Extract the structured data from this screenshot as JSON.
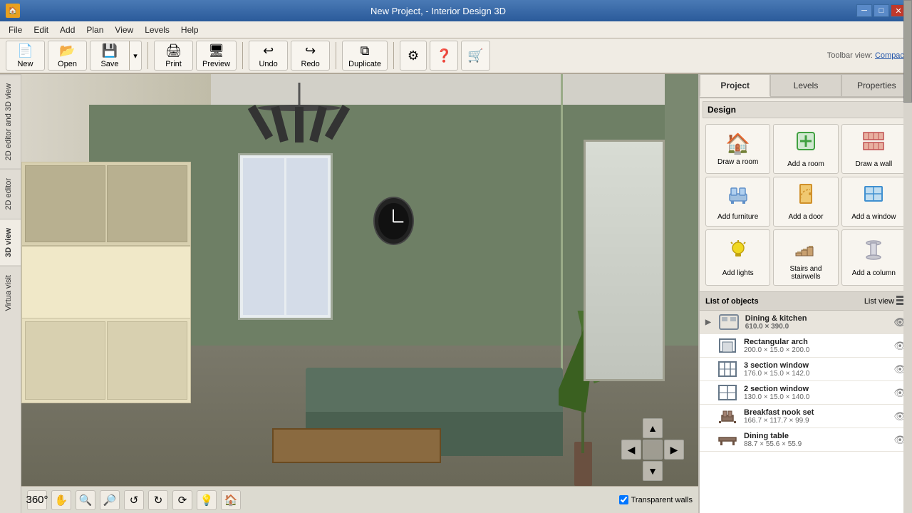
{
  "titlebar": {
    "title": "New Project, - Interior Design 3D",
    "app_icon": "🏠",
    "min_btn": "─",
    "max_btn": "□",
    "close_btn": "✕"
  },
  "menubar": {
    "items": [
      "File",
      "Edit",
      "Add",
      "Plan",
      "View",
      "Levels",
      "Help"
    ]
  },
  "toolbar": {
    "new_label": "New",
    "open_label": "Open",
    "save_label": "Save",
    "print_label": "Print",
    "preview_label": "Preview",
    "undo_label": "Undo",
    "redo_label": "Redo",
    "duplicate_label": "Duplicate",
    "settings_label": "⚙",
    "help_label": "?",
    "shop_label": "🛒",
    "toolbar_view_label": "Toolbar view:",
    "compact_label": "Compact"
  },
  "side_tabs": [
    {
      "id": "2d-3d",
      "label": "2D editor and 3D view"
    },
    {
      "id": "2d",
      "label": "2D editor"
    },
    {
      "id": "3d",
      "label": "3D view"
    },
    {
      "id": "virtual",
      "label": "Virtua visit"
    }
  ],
  "bottom_toolbar": {
    "buttons": [
      "360°",
      "✋",
      "🔍-",
      "🔍+",
      "↺",
      "↻",
      "⟳",
      "💡",
      "🏠"
    ],
    "transparent_walls_label": "Transparent walls"
  },
  "right_panel": {
    "tabs": [
      "Project",
      "Levels",
      "Properties"
    ],
    "active_tab": "Project",
    "design_section_title": "Design",
    "design_items": [
      {
        "id": "draw-room",
        "icon": "🏠",
        "label": "Draw a room"
      },
      {
        "id": "add-room",
        "icon": "➕",
        "label": "Add a room",
        "color": "green"
      },
      {
        "id": "draw-wall",
        "icon": "🧱",
        "label": "Draw a wall"
      },
      {
        "id": "add-furniture",
        "icon": "🪑",
        "label": "Add furniture"
      },
      {
        "id": "add-door",
        "icon": "🚪",
        "label": "Add a door"
      },
      {
        "id": "add-window",
        "icon": "🪟",
        "label": "Add a window"
      },
      {
        "id": "add-lights",
        "icon": "💡",
        "label": "Add lights"
      },
      {
        "id": "stairs",
        "icon": "🪜",
        "label": "Stairs and stairwells"
      },
      {
        "id": "add-column",
        "icon": "🏛",
        "label": "Add a column"
      }
    ],
    "objects_list_title": "List of objects",
    "list_view_label": "List view",
    "objects": [
      {
        "id": "dining-kitchen",
        "type": "group",
        "name": "Dining & kitchen",
        "size": "610.0 × 390.0"
      },
      {
        "id": "rect-arch",
        "type": "arch",
        "name": "Rectangular arch",
        "size": "200.0 × 15.0 × 200.0"
      },
      {
        "id": "3sec-window",
        "type": "window",
        "name": "3 section window",
        "size": "176.0 × 15.0 × 142.0"
      },
      {
        "id": "2sec-window",
        "type": "window",
        "name": "2 section window",
        "size": "130.0 × 15.0 × 140.0"
      },
      {
        "id": "breakfast-nook",
        "type": "furniture",
        "name": "Breakfast nook set",
        "size": "166.7 × 117.7 × 99.9"
      },
      {
        "id": "dining-table",
        "type": "furniture",
        "name": "Dining table",
        "size": "88.7 × 55.6 × 55.9"
      }
    ]
  },
  "nav_arrows": {
    "up": "▲",
    "down": "▼",
    "left": "◀",
    "right": "▶"
  }
}
